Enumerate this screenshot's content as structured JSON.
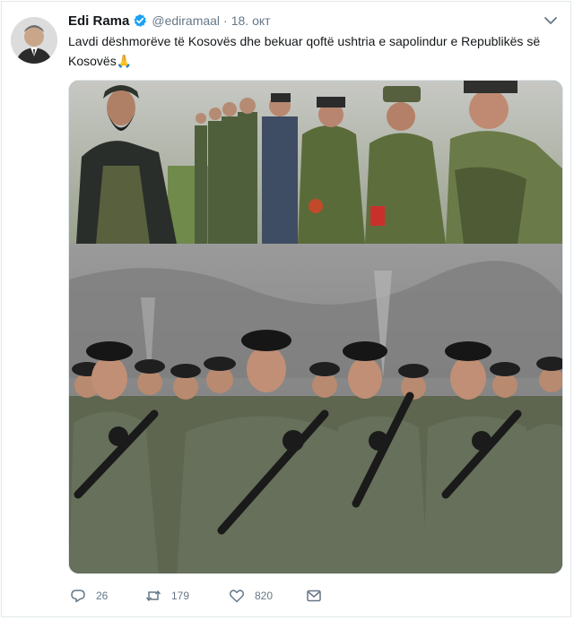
{
  "author": {
    "name": "Edi Rama",
    "handle": "@ediramaal",
    "date": "18. окт",
    "separator": "·"
  },
  "tweet": {
    "text": "Lavdi dëshmorëve të Kosovës dhe bekuar qoftë ushtria e sapolindur e Republikës së Kosovës",
    "emoji": "🙏"
  },
  "media": {
    "photo_top": "historical-soldiers-lineup",
    "photo_bottom": "modern-soldiers-formation"
  },
  "actions": {
    "reply_count": "26",
    "retweet_count": "179",
    "like_count": "820"
  },
  "colors": {
    "text": "#14171a",
    "secondary": "#657786",
    "verified": "#1da1f2",
    "border": "#e1e8ed"
  },
  "icons": [
    "verified-badge-icon",
    "caret-down-icon",
    "reply-icon",
    "retweet-icon",
    "like-icon",
    "direct-message-icon"
  ]
}
